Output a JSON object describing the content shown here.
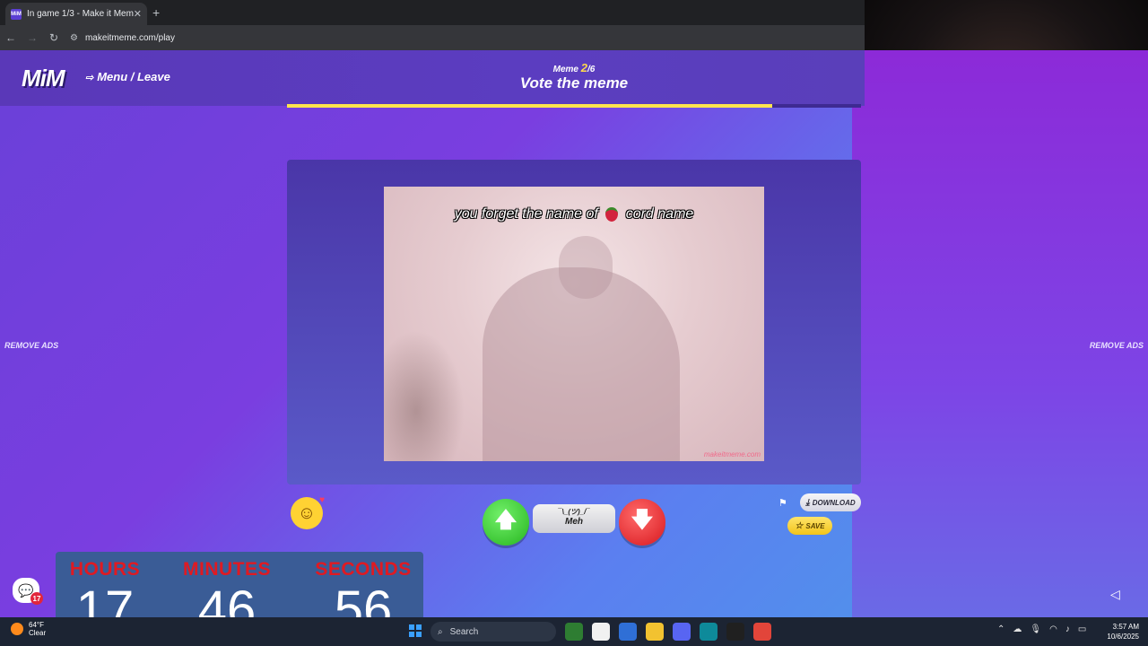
{
  "browser": {
    "tab_title": "In game 1/3 - Make it Meme",
    "favicon": "MiM",
    "url": "makeitmeme.com/play"
  },
  "header": {
    "logo": "MiM",
    "menu_label": "Menu / Leave",
    "meme_label": "Meme",
    "meme_current": "2",
    "meme_total": "/6",
    "phase": "Vote the meme",
    "progress": 0.845
  },
  "ads": {
    "left": "REMOVE ADS",
    "right": "REMOVE ADS"
  },
  "meme": {
    "caption_before": "you forget the name of",
    "caption_after": "cord name",
    "watermark": "makeitmeme.com"
  },
  "vote": {
    "up_icon": "🡅",
    "down_icon": "🡇",
    "meh_shrug": "¯\\_(ツ)_/¯",
    "meh_label": "Meh"
  },
  "actions": {
    "download_label": "DOWNLOAD",
    "save_label": "SAVE"
  },
  "chat": {
    "badge": "17"
  },
  "timer": {
    "hours_label": "HOURS",
    "hours": "17",
    "minutes_label": "MINUTES",
    "minutes": "46",
    "seconds_label": "SECONDS",
    "seconds": "56"
  },
  "taskbar": {
    "temperature": "64°F",
    "condition": "Clear",
    "search_placeholder": "Search",
    "time": "3:57 AM",
    "date": "10/6/2025"
  },
  "colors": {
    "accent_yellow": "#ffe44d",
    "vote_up": "#26b51f",
    "vote_down": "#d8181e",
    "timer_label": "#e01a22"
  }
}
